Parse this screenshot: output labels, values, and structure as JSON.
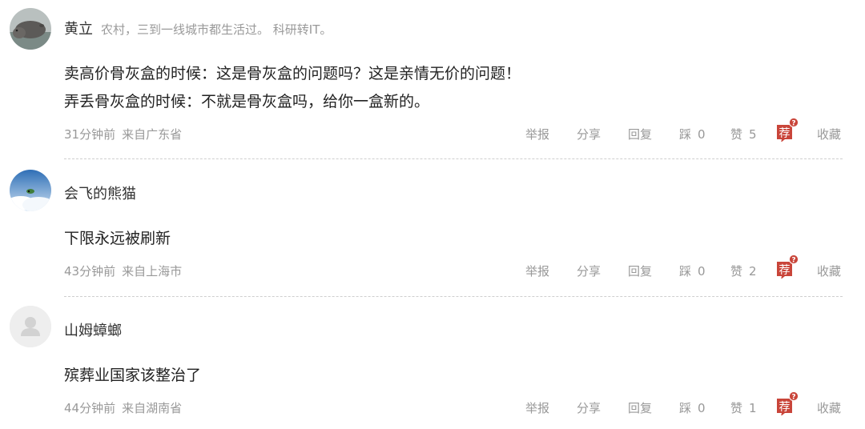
{
  "comments": [
    {
      "author": "黄立",
      "bio": "农村，三到一线城市都生活过。 科研转IT。",
      "body": [
        "卖高价骨灰盒的时候：这是骨灰盒的问题吗？这是亲情无价的问题！",
        "弄丢骨灰盒的时候：不就是骨灰盒吗，给你一盒新的。"
      ],
      "time": "31分钟前",
      "location": "来自广东省",
      "report": "举报",
      "share": "分享",
      "reply": "回复",
      "dislike_label": "踩",
      "dislike_count": "0",
      "like_label": "赞",
      "like_count": "5",
      "recommend_label": "荐",
      "recommend_badge": "?",
      "favorite": "收藏",
      "avatar_icon": "hippo-photo-avatar"
    },
    {
      "author": "会飞的熊猫",
      "bio": "",
      "body": [
        "下限永远被刷新"
      ],
      "time": "43分钟前",
      "location": "来自上海市",
      "report": "举报",
      "share": "分享",
      "reply": "回复",
      "dislike_label": "踩",
      "dislike_count": "0",
      "like_label": "赞",
      "like_count": "2",
      "recommend_label": "荐",
      "recommend_badge": "?",
      "favorite": "收藏",
      "avatar_icon": "sky-photo-avatar"
    },
    {
      "author": "山姆蟑螂",
      "bio": "",
      "body": [
        "殡葬业国家该整治了"
      ],
      "time": "44分钟前",
      "location": "来自湖南省",
      "report": "举报",
      "share": "分享",
      "reply": "回复",
      "dislike_label": "踩",
      "dislike_count": "0",
      "like_label": "赞",
      "like_count": "1",
      "recommend_label": "荐",
      "recommend_badge": "?",
      "favorite": "收藏",
      "avatar_icon": "default-user-avatar"
    }
  ],
  "colors": {
    "recommend_red": "#c9453a",
    "meta_gray": "#999999",
    "divider": "#cfcfcf"
  }
}
